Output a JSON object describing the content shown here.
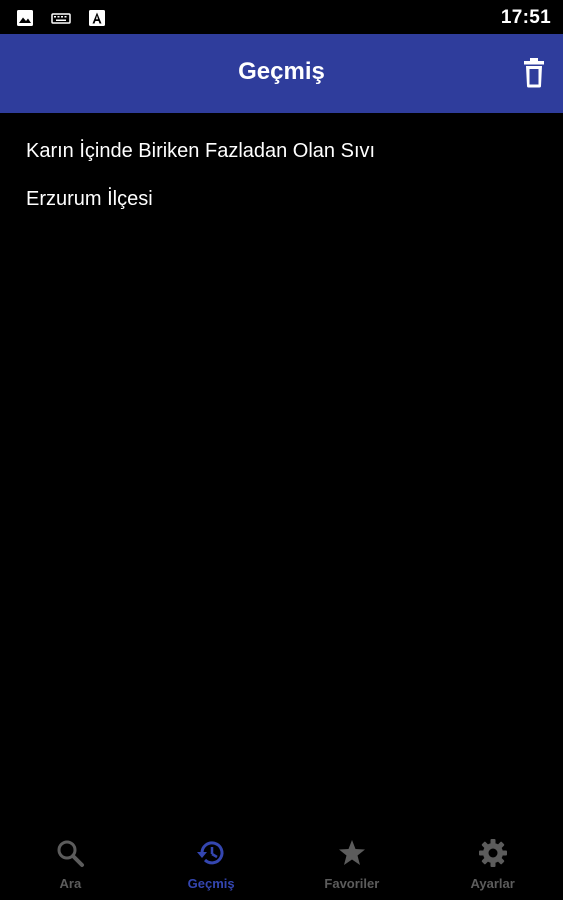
{
  "status_bar": {
    "time": "17:51",
    "icons": [
      "image-icon",
      "keyboard-icon",
      "font-a-icon"
    ]
  },
  "app_bar": {
    "title": "Geçmiş",
    "action_icon": "trash-icon"
  },
  "history": {
    "items": [
      "Karın İçinde Biriken Fazladan Olan Sıvı",
      "Erzurum İlçesi"
    ]
  },
  "bottom_nav": {
    "items": [
      {
        "label": "Ara",
        "icon": "search-icon",
        "active": false
      },
      {
        "label": "Geçmiş",
        "icon": "history-icon",
        "active": true
      },
      {
        "label": "Favoriler",
        "icon": "star-icon",
        "active": false
      },
      {
        "label": "Ayarlar",
        "icon": "gear-icon",
        "active": false
      }
    ]
  },
  "colors": {
    "app_bar": "#2f3d9c",
    "background": "#000000",
    "active_nav": "#3446b0",
    "inactive_nav": "#5c5c5c",
    "text": "#ffffff"
  }
}
